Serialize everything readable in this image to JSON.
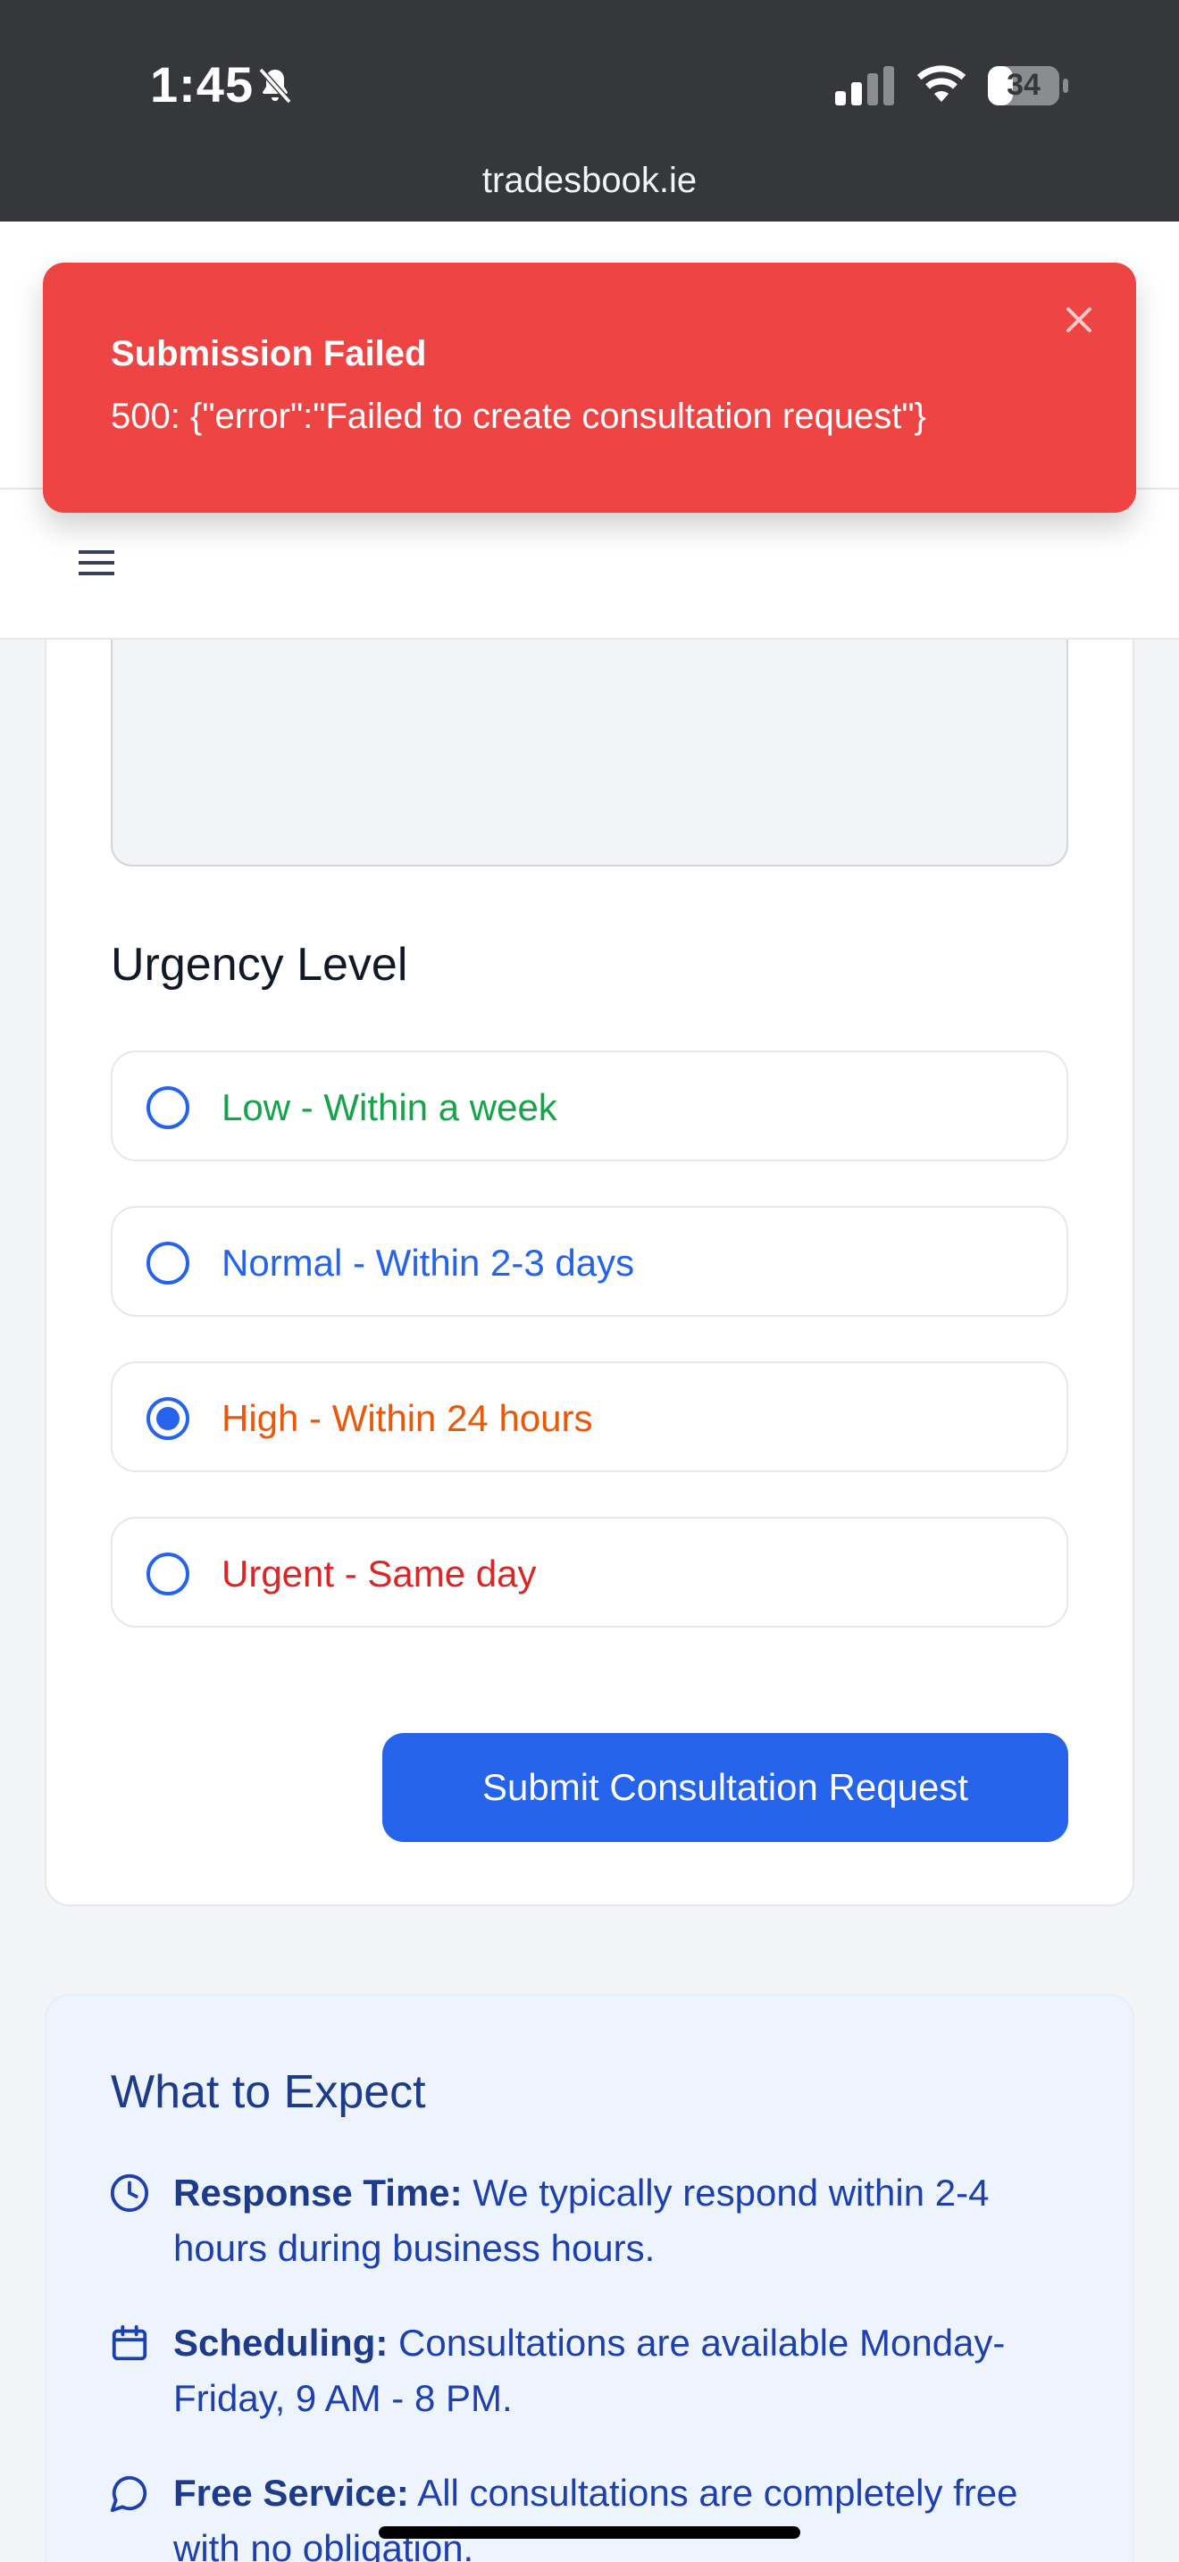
{
  "status_bar": {
    "time": "1:45",
    "battery": "34",
    "url": "tradesbook.ie"
  },
  "toast": {
    "title": "Submission Failed",
    "message": "500: {\"error\":\"Failed to create consultation request\"}",
    "color": "#ef4444"
  },
  "form": {
    "urgency_label": "Urgency Level",
    "options": [
      {
        "label": "Low - Within a week",
        "color": "#16a34a",
        "selected": false
      },
      {
        "label": "Normal - Within 2-3 days",
        "color": "#2563eb",
        "selected": false
      },
      {
        "label": "High - Within 24 hours",
        "color": "#ea580c",
        "selected": true
      },
      {
        "label": "Urgent - Same day",
        "color": "#dc2626",
        "selected": false
      }
    ],
    "submit_label": "Submit Consultation Request",
    "accent": "#2563eb"
  },
  "expect": {
    "title": "What to Expect",
    "items": [
      {
        "icon": "clock-icon",
        "bold": "Response Time:",
        "text": " We typically respond within 2-4 hours during business hours."
      },
      {
        "icon": "calendar-icon",
        "bold": "Scheduling:",
        "text": " Consultations are available Monday-Friday, 9 AM - 8 PM."
      },
      {
        "icon": "chat-icon",
        "bold": "Free Service:",
        "text": " All consultations are completely free with no obligation."
      }
    ]
  }
}
